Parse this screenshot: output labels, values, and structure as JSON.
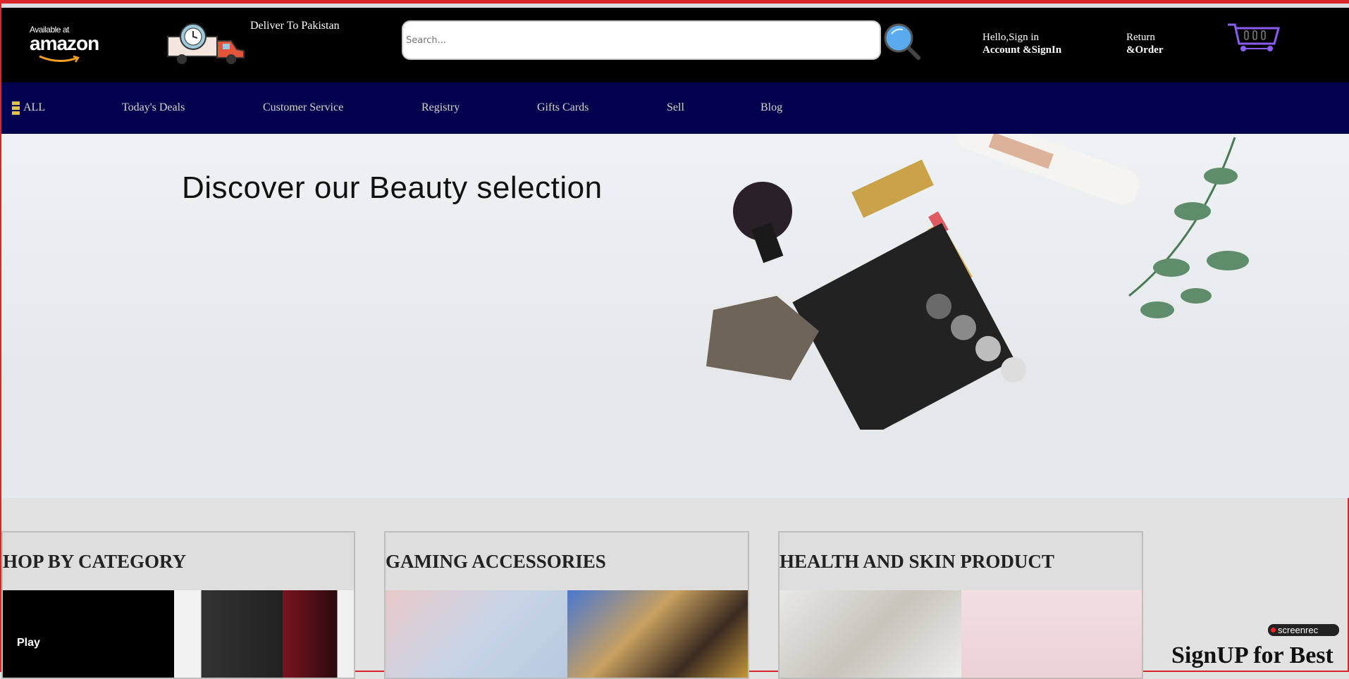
{
  "header": {
    "logo_small": "Available at",
    "logo_text": "amazon",
    "deliver_label": "Deliver To Pakistan",
    "search_placeholder": "Search...",
    "account_line1": "Hello,Sign in",
    "account_line2": "Account &SignIn",
    "returns_line1": "Return",
    "returns_line2": "&Order"
  },
  "nav": {
    "items": [
      {
        "label": "ALL"
      },
      {
        "label": "Today's Deals"
      },
      {
        "label": "Customer Service"
      },
      {
        "label": "Registry"
      },
      {
        "label": "Gifts Cards"
      },
      {
        "label": "Sell"
      },
      {
        "label": "Blog"
      }
    ]
  },
  "hero": {
    "title": "Discover our Beauty selection"
  },
  "cards": [
    {
      "title": "HOP BY CATEGORY"
    },
    {
      "title": "GAMING ACCESSORIES"
    },
    {
      "title": "HEALTH AND SKIN PRODUCT"
    }
  ],
  "overlay": {
    "play_label": "Play",
    "recorder_label": "screenrec",
    "signup_text": "SignUP for Best"
  },
  "colors": {
    "header": "#000000",
    "nav": "#02024f",
    "hero": "#e8ecee",
    "accent_cart": "#8a5cf0",
    "search_icon": "#5aaaf0"
  }
}
